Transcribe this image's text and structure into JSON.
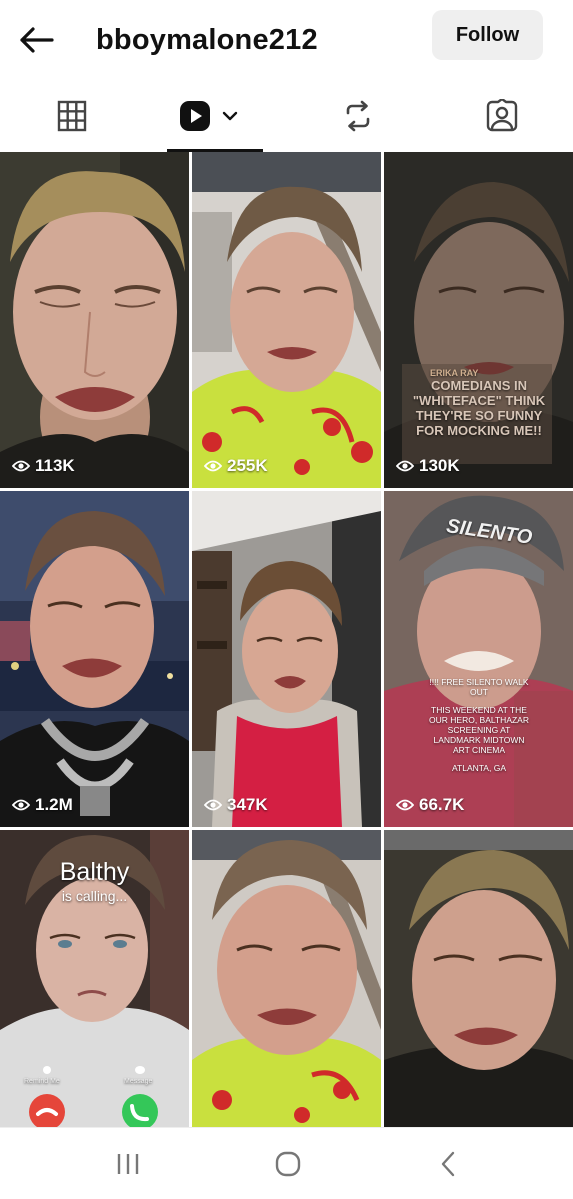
{
  "header": {
    "username": "bboymalone212",
    "follow_label": "Follow"
  },
  "tabs": [
    {
      "name": "grid",
      "icon": "grid-icon"
    },
    {
      "name": "reels",
      "icon": "reels-icon",
      "active": true
    },
    {
      "name": "reposts",
      "icon": "repost-icon"
    },
    {
      "name": "tagged",
      "icon": "tagged-icon"
    }
  ],
  "posts": [
    {
      "views": "113K"
    },
    {
      "views": "255K"
    },
    {
      "views": "130K",
      "overlay": {
        "author": "ERIKA RAY",
        "line1": "COMEDIANS IN",
        "line2": "\"WHITEFACE\" THINK",
        "line3": "THEY'RE SO FUNNY",
        "line4": "FOR MOCKING ME!!"
      }
    },
    {
      "views": "1.2M"
    },
    {
      "views": "347K"
    },
    {
      "views": "66.7K",
      "cap_text": "SILENTO",
      "overlay": {
        "line1": "!!!! FREE SILENTO WALK",
        "line2": "OUT",
        "line3": "THIS WEEKEND AT THE",
        "line4": "OUR HERO, BALTHAZAR",
        "line5": "SCREENING AT",
        "line6": "LANDMARK MIDTOWN",
        "line7": "ART CINEMA",
        "line8": "ATLANTA, GA"
      }
    },
    {
      "call": {
        "name": "Balthy",
        "status": "is calling...",
        "remind": "Remind Me",
        "message": "Message"
      }
    },
    {},
    {}
  ],
  "colors": {
    "accent": "#111111",
    "follow_bg": "#efefef",
    "decline": "#e5463a",
    "accept": "#34c759"
  }
}
